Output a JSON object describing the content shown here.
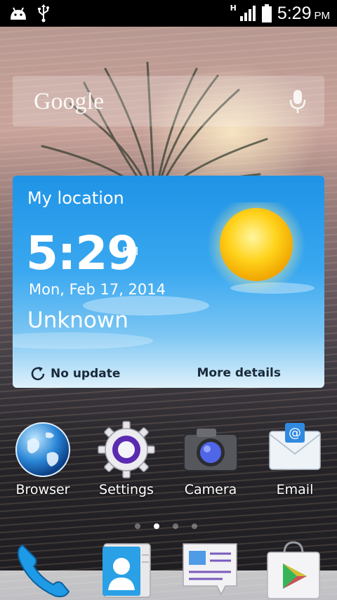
{
  "status_bar": {
    "network_type": "H",
    "time": "5:29",
    "ampm": "PM",
    "icons": [
      "android-icon",
      "usb-icon",
      "signal-icon",
      "battery-icon"
    ]
  },
  "search": {
    "logo_text": "Google",
    "icons": [
      "mic-icon"
    ]
  },
  "weather_widget": {
    "location": "My location",
    "time": "5:29",
    "ampm": "PM",
    "date": "Mon, Feb 17, 2014",
    "condition_text": "Unknown",
    "update_status": "No update",
    "details_link": "More details",
    "icons": [
      "sun-icon",
      "refresh-icon"
    ]
  },
  "apps": [
    {
      "label": "Browser",
      "icon": "globe-icon"
    },
    {
      "label": "Settings",
      "icon": "gear-icon"
    },
    {
      "label": "Camera",
      "icon": "camera-icon"
    },
    {
      "label": "Email",
      "icon": "envelope-icon"
    }
  ],
  "page_indicator": {
    "pages": 4,
    "active_page": 2
  },
  "dock": [
    {
      "icon": "phone-icon"
    },
    {
      "icon": "contacts-icon"
    },
    {
      "icon": "messaging-icon"
    },
    {
      "icon": "play-store-icon"
    }
  ],
  "colors": {
    "widget_sky_top": "#1f93e6",
    "widget_sky_bottom": "#dff1fb",
    "footer_text": "#1a2a3a"
  }
}
